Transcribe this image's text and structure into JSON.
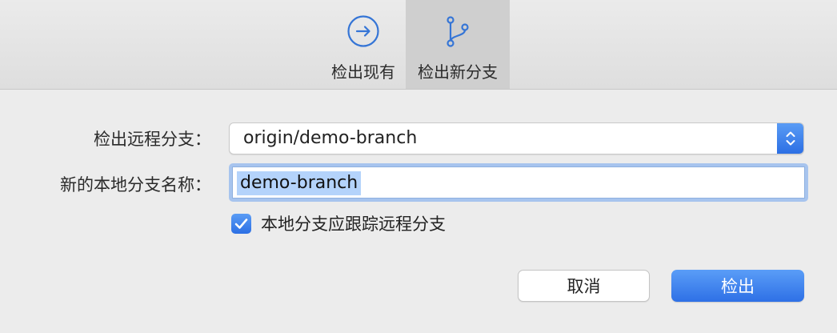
{
  "toolbar": {
    "items": [
      {
        "label": "检出现有",
        "icon": "arrow-right-circle-icon",
        "selected": false
      },
      {
        "label": "检出新分支",
        "icon": "git-branch-icon",
        "selected": true
      }
    ]
  },
  "form": {
    "remote_branch_label": "检出远程分支：",
    "remote_branch_value": "origin/demo-branch",
    "local_branch_label": "新的本地分支名称：",
    "local_branch_value": "demo-branch",
    "track_checkbox_label": "本地分支应跟踪远程分支",
    "track_checked": true
  },
  "buttons": {
    "cancel": "取消",
    "checkout": "检出"
  },
  "colors": {
    "accent": "#3478f6",
    "selection": "#b4d3fb",
    "focus_ring": "#a7c4ee"
  }
}
